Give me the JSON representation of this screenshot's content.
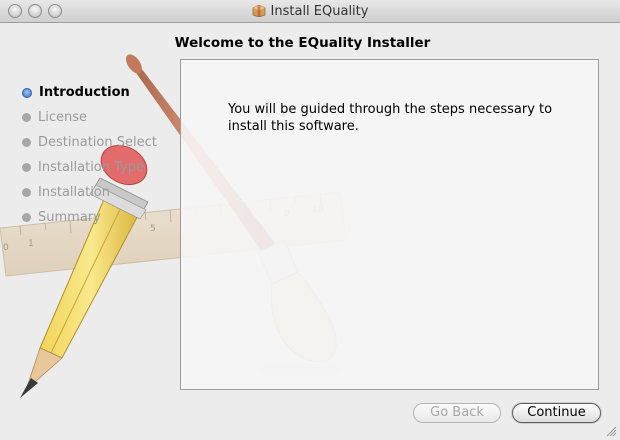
{
  "window": {
    "title": "Install EQuality",
    "title_icon": "package-icon"
  },
  "heading": "Welcome to the EQuality Installer",
  "steps": [
    {
      "label": "Introduction",
      "active": true
    },
    {
      "label": "License",
      "active": false
    },
    {
      "label": "Destination Select",
      "active": false
    },
    {
      "label": "Installation Type",
      "active": false
    },
    {
      "label": "Installation",
      "active": false
    },
    {
      "label": "Summary",
      "active": false
    }
  ],
  "content": {
    "text": "You will be guided through the steps necessary to install this software."
  },
  "buttons": {
    "back": "Go Back",
    "continue": "Continue"
  },
  "colors": {
    "active_step": "#3c72c6",
    "inactive_step": "#9a9a9a"
  }
}
